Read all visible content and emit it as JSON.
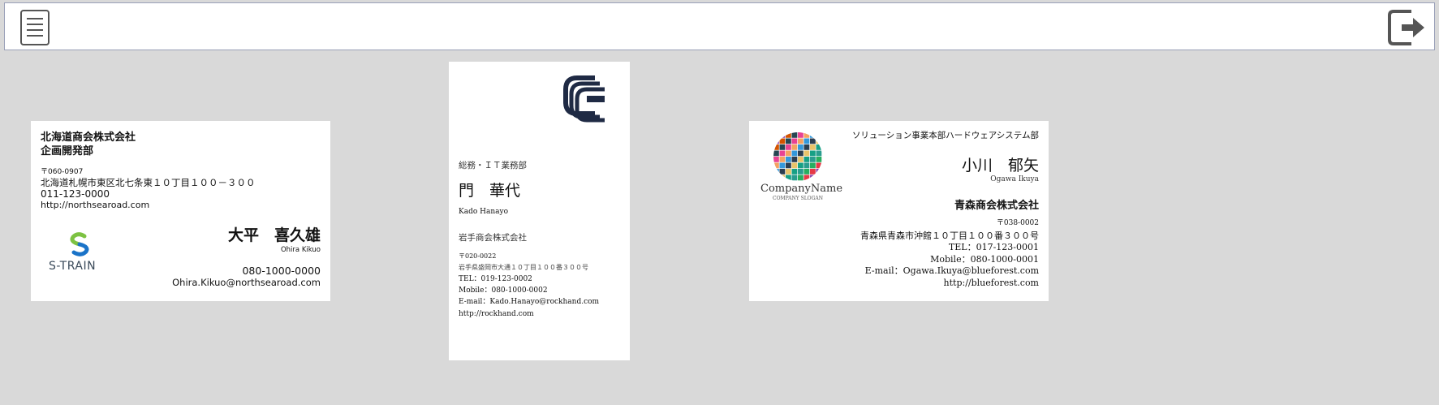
{
  "toolbar": {
    "menu_icon": "menu-icon",
    "logout_icon": "logout-icon"
  },
  "card_a": {
    "company": "北海道商会株式会社",
    "department": "企画開発部",
    "postal": "〒060-0907",
    "address": "北海道札幌市東区北七条東１０丁目１００－３００",
    "phone": "011-123-0000",
    "url": "http://northsearoad.com",
    "logo_text": "S-TRAIN",
    "name": "大平　喜久雄",
    "name_romaji": "Ohira Kikuo",
    "mobile": "080-1000-0000",
    "email": "Ohira.Kikuo@northsearoad.com",
    "logo_colors": {
      "green": "#7dc242",
      "blue": "#1a73c8"
    }
  },
  "card_b": {
    "department": "総務・ＩＴ業務部",
    "name": "門　華代",
    "name_romaji": "Kado Hanayo",
    "company": "岩手商会株式会社",
    "postal": "〒020-0022",
    "address": "岩手県盛岡市大通１０丁目１００番３００号",
    "tel": "TEL：019-123-0002",
    "mobile": "Mobile：080-1000-0002",
    "email": "E-mail：Kado.Hanayo@rockhand.com",
    "url": "http://rockhand.com",
    "logo_color": "#1f2a44"
  },
  "card_c": {
    "logo_name": "CompanyName",
    "logo_slogan": "COMPANY SLOGAN",
    "department": "ソリューション事業本部ハードウェアシステム部",
    "name": "小川　郁矢",
    "name_romaji": "Ogawa Ikuya",
    "company": "青森商会株式会社",
    "postal": "〒038-0002",
    "address": "青森県青森市沖館１０丁目１００番３００号",
    "tel": "TEL：017-123-0001",
    "mobile": "Mobile：080-1000-0001",
    "email": "E-mail：Ogawa.Ikuya@blueforest.com",
    "url": "http://blueforest.com"
  }
}
